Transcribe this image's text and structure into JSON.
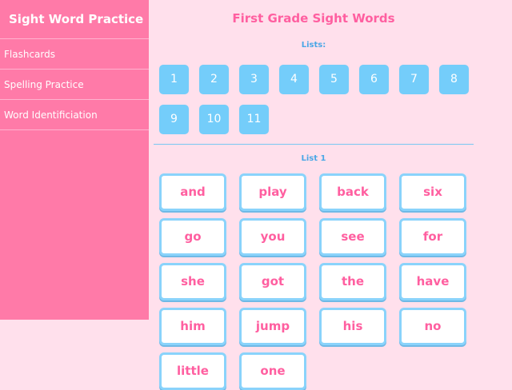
{
  "sidebar": {
    "title": "Sight Word Practice",
    "items": [
      {
        "label": "Flashcards"
      },
      {
        "label": "Spelling Practice"
      },
      {
        "label": "Word Identificiation"
      }
    ]
  },
  "main": {
    "title": "First Grade Sight Words",
    "lists_label": "Lists:",
    "lists": [
      "1",
      "2",
      "3",
      "4",
      "5",
      "6",
      "7",
      "8",
      "9",
      "10",
      "11"
    ],
    "current_list_label": "List 1",
    "words": [
      "and",
      "play",
      "back",
      "six",
      "go",
      "you",
      "see",
      "for",
      "she",
      "got",
      "the",
      "have",
      "him",
      "jump",
      "his",
      "no",
      "little",
      "one"
    ]
  },
  "colors": {
    "sidebar_bg": "#ff7aa8",
    "page_bg": "#ffe0ec",
    "accent_pink": "#ff5fa0",
    "button_blue": "#74cdfa",
    "label_blue": "#4aa7e6"
  }
}
